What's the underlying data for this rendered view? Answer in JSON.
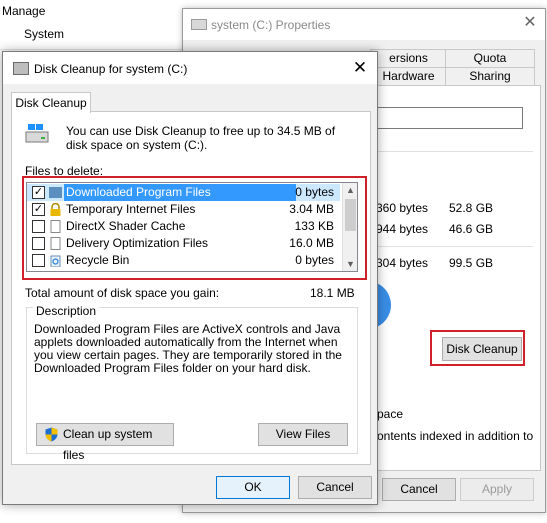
{
  "explorer": {
    "manage": "Manage",
    "system": "System"
  },
  "properties": {
    "title": "system (C:) Properties",
    "tabs": {
      "versions": "ersions",
      "quota": "Quota",
      "hardware": "Hardware",
      "sharing": "Sharing"
    },
    "used_bytes": "360 bytes",
    "used_size": "52.8 GB",
    "free_bytes": "944 bytes",
    "free_size": "46.6 GB",
    "capacity_bytes": "304 bytes",
    "capacity_size": "99.5 GB",
    "disk_cleanup_button": "Disk Cleanup",
    "compress_text": "pace",
    "index_text": "ontents indexed in addition to",
    "cancel": "Cancel",
    "apply": "Apply",
    "colon": ":"
  },
  "dialog": {
    "title": "Disk Cleanup for system (C:)",
    "tab": "Disk Cleanup",
    "info": "You can use Disk Cleanup to free up to 34.5 MB of disk space on system (C:).",
    "files_label": "Files to delete:",
    "files": [
      {
        "name": "Downloaded Program Files",
        "size": "0 bytes",
        "checked": true,
        "selected": true,
        "icon": "folder-icon"
      },
      {
        "name": "Temporary Internet Files",
        "size": "3.04 MB",
        "checked": true,
        "selected": false,
        "icon": "lock-icon"
      },
      {
        "name": "DirectX Shader Cache",
        "size": "133 KB",
        "checked": false,
        "selected": false,
        "icon": "file-icon"
      },
      {
        "name": "Delivery Optimization Files",
        "size": "16.0 MB",
        "checked": false,
        "selected": false,
        "icon": "file-icon"
      },
      {
        "name": "Recycle Bin",
        "size": "0 bytes",
        "checked": false,
        "selected": false,
        "icon": "recycle-bin-icon"
      }
    ],
    "total_label": "Total amount of disk space you gain:",
    "total_value": "18.1 MB",
    "description_title": "Description",
    "description": "Downloaded Program Files are ActiveX controls and Java applets downloaded automatically from the Internet when you view certain pages. They are temporarily stored in the Downloaded Program Files folder on your hard disk.",
    "cleanup_system_button": "Clean up system files",
    "view_files_button": "View Files",
    "ok": "OK",
    "cancel": "Cancel"
  },
  "colors": {
    "highlight_red": "#d0202a",
    "selection_blue": "#3399ff",
    "accent_blue": "#0078d7"
  }
}
